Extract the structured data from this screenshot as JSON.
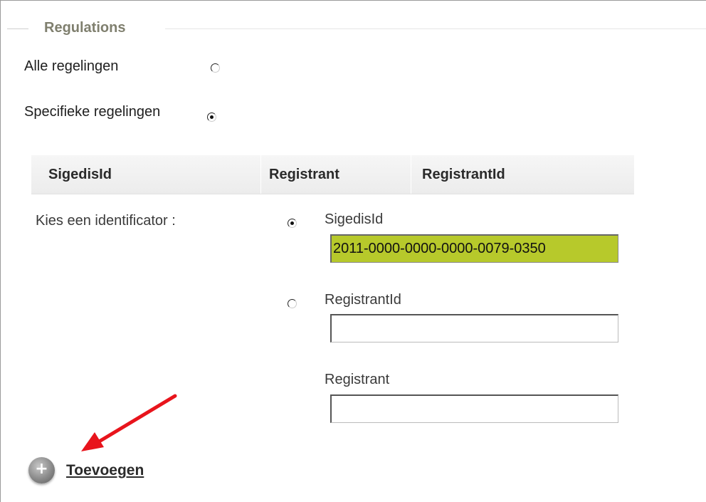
{
  "fieldset": {
    "legend": "Regulations"
  },
  "scope_options": [
    {
      "label": "Alle regelingen",
      "selected": false
    },
    {
      "label": "Specifieke regelingen",
      "selected": true
    }
  ],
  "tabs": [
    {
      "label": "SigedisId"
    },
    {
      "label": "Registrant"
    },
    {
      "label": "RegistrantId"
    }
  ],
  "identifier": {
    "prompt": "Kies een identificator :",
    "options": [
      {
        "label": "SigedisId",
        "selected": true,
        "value": "2011-0000-0000-0000-0079-0350"
      },
      {
        "label": "RegistrantId",
        "selected": false,
        "value": ""
      }
    ],
    "registrant": {
      "label": "Registrant",
      "value": ""
    }
  },
  "actions": {
    "add_label": "Toevoegen",
    "add_icon": "plus-icon"
  },
  "colors": {
    "legend": "#7f7f6e",
    "active_input": "#b7c92b",
    "annotation_arrow": "#e8141c"
  }
}
